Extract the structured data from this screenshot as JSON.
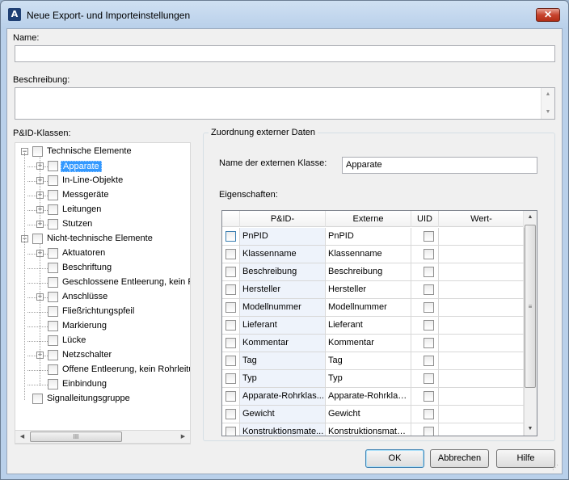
{
  "window": {
    "title": "Neue Export- und Importeinstellungen",
    "app_icon_letter": "A",
    "close_glyph": "✕"
  },
  "name": {
    "label": "Name:",
    "value": ""
  },
  "description": {
    "label": "Beschreibung:",
    "value": ""
  },
  "classes": {
    "label": "P&ID-Klassen:",
    "tree": [
      {
        "label": "Technische Elemente",
        "expander": "−",
        "checked": false
      },
      {
        "label": "Apparate",
        "expander": "+",
        "checked": false,
        "selected": true
      },
      {
        "label": "In-Line-Objekte",
        "expander": "+",
        "checked": false
      },
      {
        "label": "Messgeräte",
        "expander": "+",
        "checked": false
      },
      {
        "label": "Leitungen",
        "expander": "+",
        "checked": false
      },
      {
        "label": "Stutzen",
        "expander": "+",
        "checked": false
      },
      {
        "label": "Nicht-technische Elemente",
        "expander": "−",
        "checked": false
      },
      {
        "label": "Aktuatoren",
        "expander": "+",
        "checked": false
      },
      {
        "label": "Beschriftung",
        "expander": "",
        "checked": false
      },
      {
        "label": "Geschlossene Entleerung, kein Rohrleitungsabzweig",
        "expander": "",
        "checked": false
      },
      {
        "label": "Anschlüsse",
        "expander": "+",
        "checked": false
      },
      {
        "label": "Fließrichtungspfeil",
        "expander": "",
        "checked": false
      },
      {
        "label": "Markierung",
        "expander": "",
        "checked": false
      },
      {
        "label": "Lücke",
        "expander": "",
        "checked": false
      },
      {
        "label": "Netzschalter",
        "expander": "+",
        "checked": false
      },
      {
        "label": "Offene Entleerung, kein Rohrleitungsabzweig",
        "expander": "",
        "checked": false
      },
      {
        "label": "Einbindung",
        "expander": "",
        "checked": false
      },
      {
        "label": "Signalleitungsgruppe",
        "expander": "",
        "checked": false
      }
    ],
    "hscroll_thumb_glyph": "III"
  },
  "mapping": {
    "group_title": "Zuordnung externer Daten",
    "external_class_label": "Name der externen Klasse:",
    "external_class_value": "Apparate",
    "properties_label": "Eigenschaften:",
    "columns": [
      "",
      "P&ID-",
      "Externe",
      "UID",
      "Wert-"
    ],
    "rows": [
      {
        "checked": false,
        "pid": "PnPID",
        "external": "PnPID",
        "uid": false
      },
      {
        "checked": false,
        "pid": "Klassenname",
        "external": "Klassenname",
        "uid": false
      },
      {
        "checked": false,
        "pid": "Beschreibung",
        "external": "Beschreibung",
        "uid": false
      },
      {
        "checked": false,
        "pid": "Hersteller",
        "external": "Hersteller",
        "uid": false
      },
      {
        "checked": false,
        "pid": "Modellnummer",
        "external": "Modellnummer",
        "uid": false
      },
      {
        "checked": false,
        "pid": "Lieferant",
        "external": "Lieferant",
        "uid": false
      },
      {
        "checked": false,
        "pid": "Kommentar",
        "external": "Kommentar",
        "uid": false
      },
      {
        "checked": false,
        "pid": "Tag",
        "external": "Tag",
        "uid": false
      },
      {
        "checked": false,
        "pid": "Typ",
        "external": "Typ",
        "uid": false
      },
      {
        "checked": false,
        "pid": "Apparate-Rohrklas...",
        "external": "Apparate-Rohrklasse",
        "uid": false
      },
      {
        "checked": false,
        "pid": "Gewicht",
        "external": "Gewicht",
        "uid": false
      },
      {
        "checked": false,
        "pid": "Konstruktionsmate...",
        "external": "Konstruktionsmater...",
        "uid": false
      }
    ],
    "vscroll_thumb_glyph": "≡"
  },
  "buttons": {
    "ok": "OK",
    "cancel": "Abbrechen",
    "help": "Hilfe"
  },
  "icons": {
    "arrow_up": "▲",
    "arrow_down": "▼",
    "arrow_left": "◀",
    "arrow_right": "▶",
    "grip": "⋰"
  },
  "colors": {
    "selection": "#3399ff",
    "title_bar": "#b9d0ea",
    "close_button": "#c7442e"
  }
}
